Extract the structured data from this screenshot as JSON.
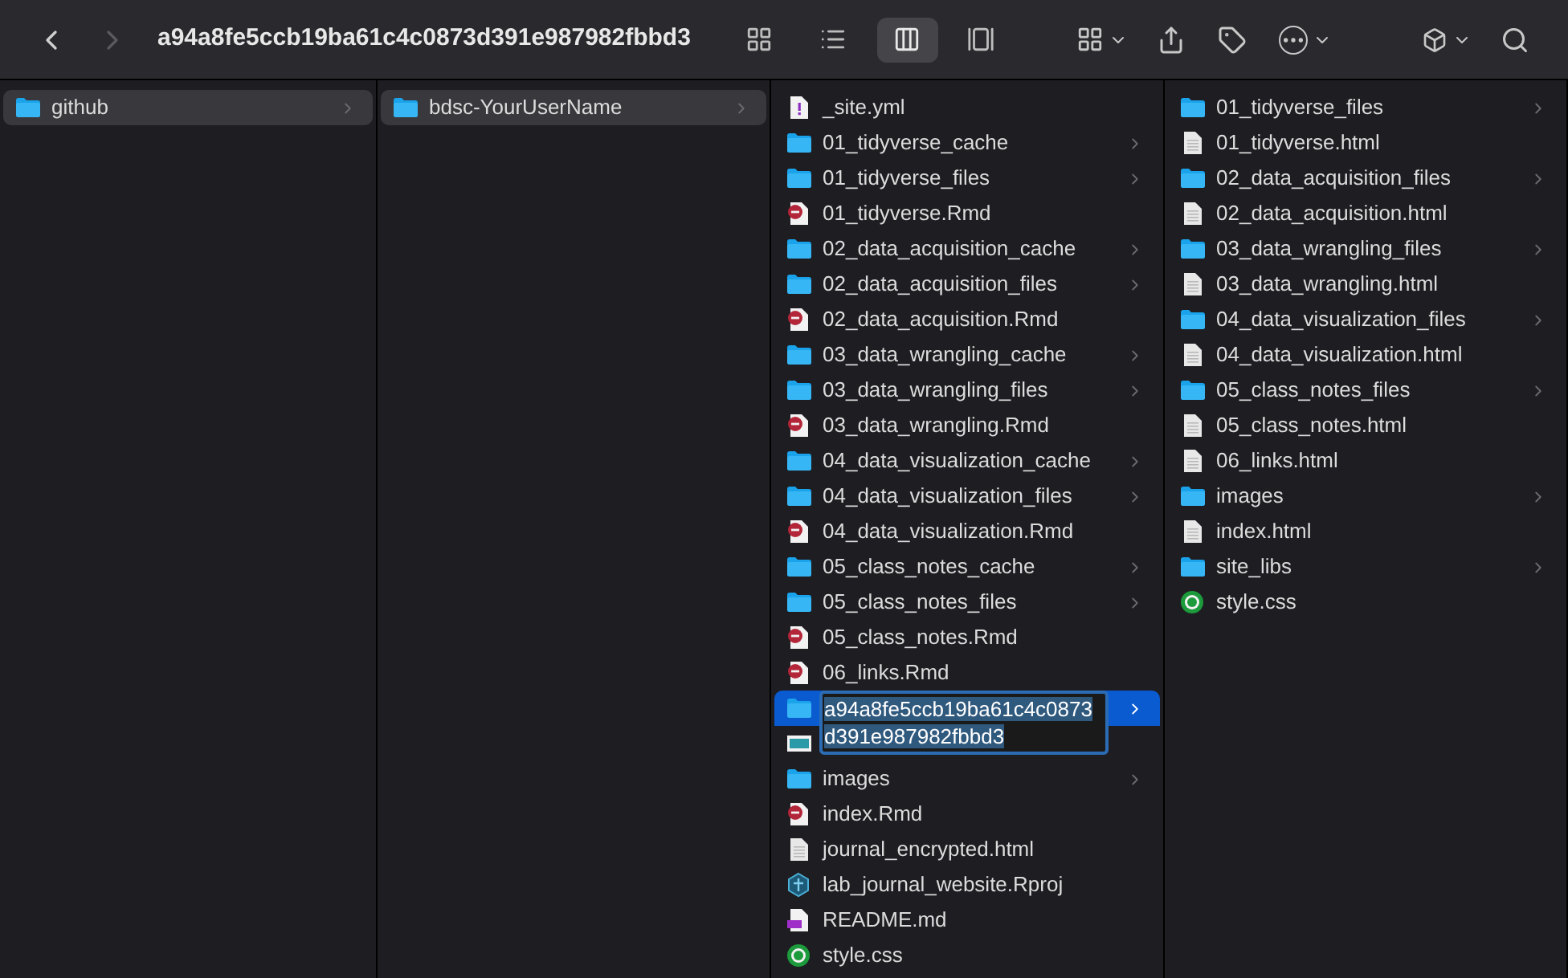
{
  "window": {
    "title": "a94a8fe5ccb19ba61c4c0873d391e987982fbbd3"
  },
  "toolbar": {
    "back_enabled": true,
    "forward_enabled": false,
    "views": [
      {
        "kind": "icons",
        "selected": false
      },
      {
        "kind": "list",
        "selected": false
      },
      {
        "kind": "columns",
        "selected": true
      },
      {
        "kind": "gallery",
        "selected": false
      }
    ]
  },
  "columns": [
    {
      "items": [
        {
          "kind": "folder",
          "name": "github",
          "selected": true
        }
      ]
    },
    {
      "items": [
        {
          "kind": "folder",
          "name": "bdsc-YourUserName",
          "selected": true
        }
      ]
    },
    {
      "items": [
        {
          "kind": "yml",
          "name": "_site.yml",
          "selected": false
        },
        {
          "kind": "folder",
          "name": "01_tidyverse_cache",
          "selected": false
        },
        {
          "kind": "folder",
          "name": "01_tidyverse_files",
          "selected": false
        },
        {
          "kind": "rmd",
          "name": "01_tidyverse.Rmd",
          "selected": false
        },
        {
          "kind": "folder",
          "name": "02_data_acquisition_cache",
          "selected": false
        },
        {
          "kind": "folder",
          "name": "02_data_acquisition_files",
          "selected": false
        },
        {
          "kind": "rmd",
          "name": "02_data_acquisition.Rmd",
          "selected": false
        },
        {
          "kind": "folder",
          "name": "03_data_wrangling_cache",
          "selected": false
        },
        {
          "kind": "folder",
          "name": "03_data_wrangling_files",
          "selected": false
        },
        {
          "kind": "rmd",
          "name": "03_data_wrangling.Rmd",
          "selected": false
        },
        {
          "kind": "folder",
          "name": "04_data_visualization_cache",
          "selected": false
        },
        {
          "kind": "folder",
          "name": "04_data_visualization_files",
          "selected": false
        },
        {
          "kind": "rmd",
          "name": "04_data_visualization.Rmd",
          "selected": false
        },
        {
          "kind": "folder",
          "name": "05_class_notes_cache",
          "selected": false
        },
        {
          "kind": "folder",
          "name": "05_class_notes_files",
          "selected": false
        },
        {
          "kind": "rmd",
          "name": "05_class_notes.Rmd",
          "selected": false
        },
        {
          "kind": "rmd",
          "name": "06_links.Rmd",
          "selected": false
        },
        {
          "kind": "folder",
          "selected": true,
          "rename_value": "a94a8fe5ccb19ba61c4c0873d391e987982fbbd3"
        },
        {
          "kind": "image"
        },
        {
          "kind": "folder",
          "name": "images",
          "selected": false
        },
        {
          "kind": "rmd",
          "name": "index.Rmd",
          "selected": false
        },
        {
          "kind": "html",
          "name": "journal_encrypted.html",
          "selected": false
        },
        {
          "kind": "rproj",
          "name": "lab_journal_website.Rproj",
          "selected": false
        },
        {
          "kind": "md",
          "name": "README.md",
          "selected": false
        },
        {
          "kind": "css",
          "name": "style.css",
          "selected": false
        }
      ]
    },
    {
      "items": [
        {
          "kind": "folder",
          "name": "01_tidyverse_files",
          "selected": false
        },
        {
          "kind": "html",
          "name": "01_tidyverse.html",
          "selected": false
        },
        {
          "kind": "folder",
          "name": "02_data_acquisition_files",
          "selected": false
        },
        {
          "kind": "html",
          "name": "02_data_acquisition.html",
          "selected": false
        },
        {
          "kind": "folder",
          "name": "03_data_wrangling_files",
          "selected": false
        },
        {
          "kind": "html",
          "name": "03_data_wrangling.html",
          "selected": false
        },
        {
          "kind": "folder",
          "name": "04_data_visualization_files",
          "selected": false
        },
        {
          "kind": "html",
          "name": "04_data_visualization.html",
          "selected": false
        },
        {
          "kind": "folder",
          "name": "05_class_notes_files",
          "selected": false
        },
        {
          "kind": "html",
          "name": "05_class_notes.html",
          "selected": false
        },
        {
          "kind": "html",
          "name": "06_links.html",
          "selected": false
        },
        {
          "kind": "folder",
          "name": "images",
          "selected": false
        },
        {
          "kind": "html",
          "name": "index.html",
          "selected": false
        },
        {
          "kind": "folder",
          "name": "site_libs",
          "selected": false
        },
        {
          "kind": "css",
          "name": "style.css",
          "selected": false
        }
      ]
    }
  ]
}
